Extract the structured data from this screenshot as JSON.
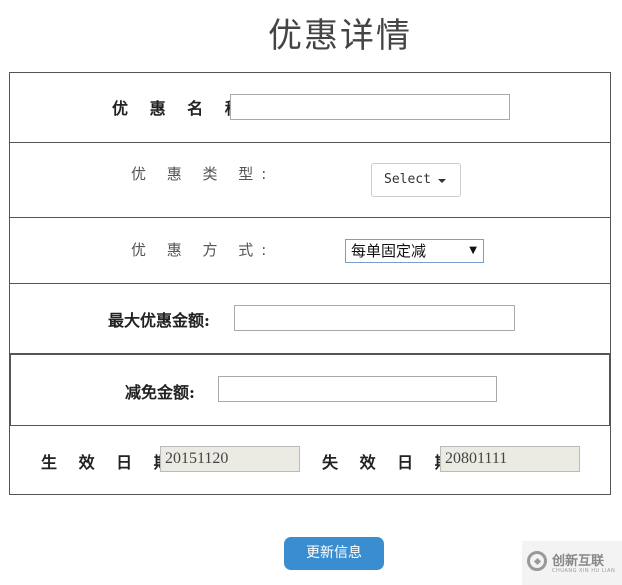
{
  "page": {
    "title": "优惠详情"
  },
  "form": {
    "name_label": "优 惠 名 称:",
    "name_value": "",
    "type_label": "优 惠 类 型:",
    "type_select": "Select",
    "method_label": "优 惠 方 式:",
    "method_select": "每单固定减",
    "max_amount_label": "最大优惠金额:",
    "max_amount_value": "",
    "reduce_amount_label": "减免金额:",
    "reduce_amount_value": "",
    "start_date_label": "生 效 日 期:",
    "start_date_value": "20151120",
    "end_date_label": "失 效 日 期:",
    "end_date_value": "20801111"
  },
  "actions": {
    "update_label": "更新信息"
  },
  "watermark": {
    "text": "创新互联",
    "subtext": "CHUANG XIN HU LIAN"
  }
}
